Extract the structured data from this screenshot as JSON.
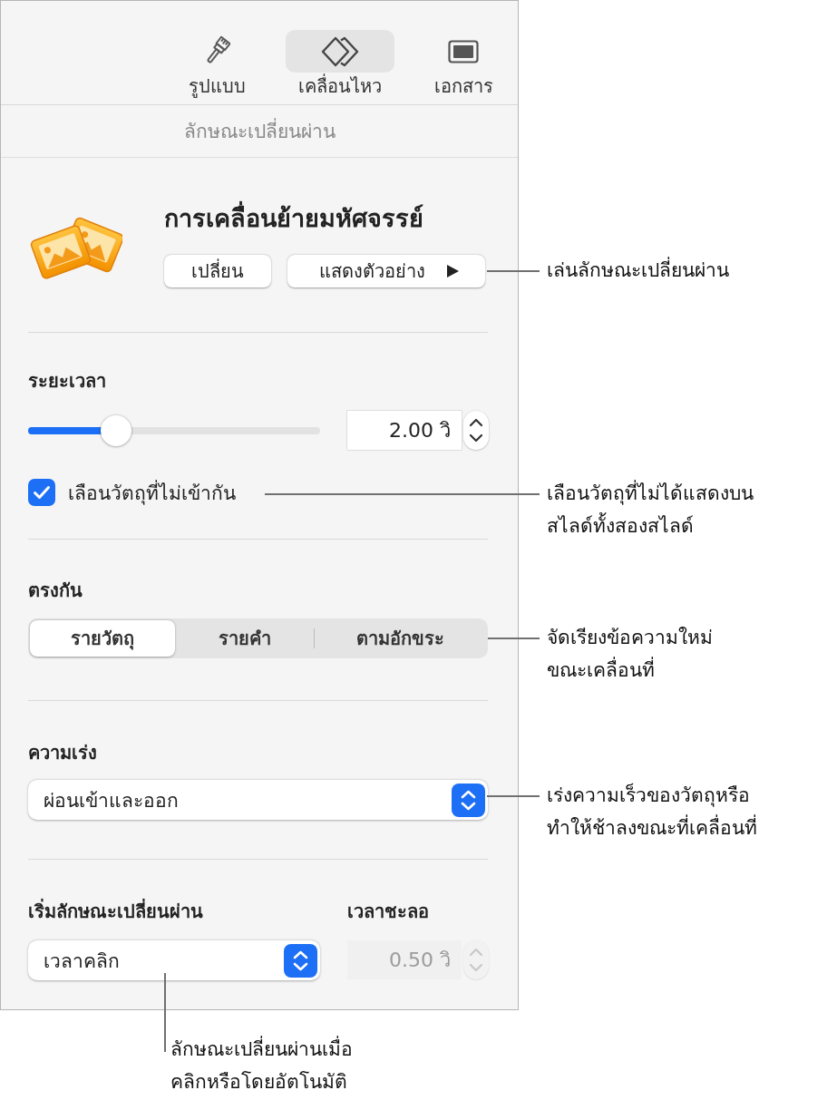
{
  "inspector_tabs": [
    {
      "label": "รูปแบบ",
      "kind": "format",
      "selected": false
    },
    {
      "label": "เคลื่อนไหว",
      "kind": "animate",
      "selected": true
    },
    {
      "label": "เอกสาร",
      "kind": "document",
      "selected": false
    }
  ],
  "section_title": "ลักษณะเปลี่ยนผ่าน",
  "transition": {
    "name": "การเคลื่อนย้ายมหัศจรรย์",
    "buttons": [
      {
        "label": "เปลี่ยน",
        "kind": "plain"
      },
      {
        "label": "แสดงตัวอย่าง",
        "kind": "play"
      }
    ]
  },
  "duration": {
    "label": "ระยะเวลา",
    "level": 0.3,
    "value": "2.00 วิ"
  },
  "fade_checkbox": {
    "label": "เลือนวัตถุที่ไม่เข้ากัน",
    "checked": true
  },
  "match": {
    "label": "ตรงกัน",
    "options": [
      {
        "label": "รายวัตถุ",
        "selected": true
      },
      {
        "label": "รายคำ",
        "selected": false
      },
      {
        "label": "ตามอักขระ",
        "selected": false
      }
    ]
  },
  "acceleration": {
    "label": "ความเร่ง",
    "value": "ผ่อนเข้าและออก"
  },
  "start": {
    "label": "เริ่มลักษณะเปลี่ยนผ่าน",
    "value": "เวลาคลิก"
  },
  "delay": {
    "label": "เวลาชะลอ",
    "value": "0.50 วิ",
    "disabled": true
  },
  "callouts": [
    {
      "lines": [
        "เล่นลักษณะเปลี่ยนผ่าน"
      ]
    },
    {
      "lines": [
        "เลือนวัตถุที่ไม่ได้แสดงบน",
        "สไลด์ทั้งสองสไลด์"
      ]
    },
    {
      "lines": [
        "จัดเรียงข้อความใหม่",
        "ขณะเคลื่อนที่"
      ]
    },
    {
      "lines": [
        "เร่งความเร็วของวัตถุหรือ",
        "ทำให้ช้าลงขณะที่เคลื่อนที่"
      ]
    },
    {
      "lines": [
        "ลักษณะเปลี่ยนผ่านเมื่อ",
        "คลิกหรือโดยอัตโนมัติ"
      ]
    }
  ]
}
